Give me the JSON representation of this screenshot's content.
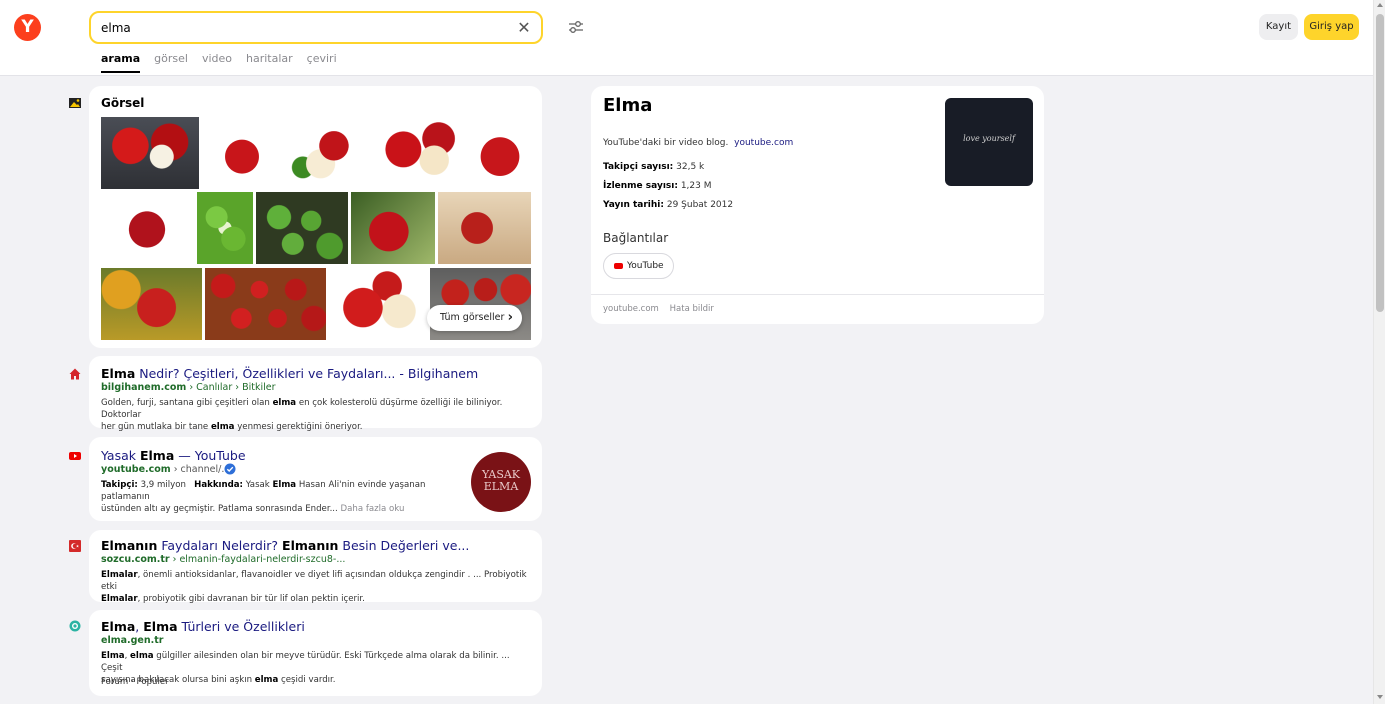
{
  "header": {
    "logo_text": "Y",
    "search_value": "elma",
    "tabs": [
      {
        "label": "arama",
        "active": true
      },
      {
        "label": "görsel",
        "active": false
      },
      {
        "label": "video",
        "active": false
      },
      {
        "label": "haritalar",
        "active": false
      },
      {
        "label": "çeviri",
        "active": false
      }
    ],
    "register_label": "Kayıt",
    "login_label": "Giriş yap"
  },
  "images": {
    "title": "Görsel",
    "all_label": "Tüm görseller"
  },
  "results": [
    {
      "title_pre": "",
      "title_b": "Elma",
      "title_post": " Nedir? Çeşitleri, Özellikleri ve Faydaları... - Bilgihanem",
      "url_host": "bilgihanem.com",
      "url_path": " › Canlılar › Bitkiler",
      "snippet_line1": "Golden, furji, santana gibi çeşitleri olan ",
      "snippet_b1": "elma",
      "snippet_line1b": " en çok kolesterolü düşürme özelliği ile biliniyor. Doktorlar",
      "snippet_line2": "her gün mutlaka bir tane ",
      "snippet_b2": "elma",
      "snippet_line2b": " yenmesi gerektiğini öneriyor."
    },
    {
      "title_pre": "Yasak ",
      "title_b": "Elma",
      "title_post": " — YouTube",
      "url_host": "youtube.com",
      "url_path": " › channel/...",
      "followers_label": "Takipçi:",
      "followers_value": " 3,9 milyon",
      "about_label": "Hakkında:",
      "about_text1": " Yasak ",
      "about_b": "Elma",
      "about_text2": " Hasan Ali'nin evinde yaşanan patlamanın",
      "about_line2": "üstünden altı ay geçmiştir. Patlama sonrasında Ender... ",
      "more_label": "Daha fazla oku",
      "thumb_text_1": "YASAK",
      "thumb_text_2": "ELMA"
    },
    {
      "title_b": "Elmanın",
      "title_mid": " Faydaları Nelerdir? ",
      "title_b2": "Elmanın",
      "title_post": " Besin Değerleri ve...",
      "url_host": "sozcu.com.tr",
      "url_path": " › elmanin-faydalari-nelerdir-szcu8-...",
      "snippet_b1": "Elmalar",
      "snippet_line1": ", önemli antioksidanlar, flavanoidler ve diyet lifi açısından oldukça zengindir . ... Probiyotik etki",
      "snippet_b2": "Elmalar",
      "snippet_line2": ", probiyotik gibi davranan bir tür lif olan pektin içerir."
    },
    {
      "title_b": "Elma",
      "title_mid": ", ",
      "title_b2": "Elma",
      "title_post": " Türleri ve Özellikleri",
      "url_host": "elma.gen.tr",
      "snippet_b1": "Elma",
      "snippet_mid": ", ",
      "snippet_b2": "elma",
      "snippet_line1": " gülgiller ailesinden olan bir meyve türüdür. Eski Türkçede alma olarak da bilinir. ... Çeşit",
      "snippet_line2a": "sayısına bakılacak olursa bini aşkın ",
      "snippet_b3": "elma",
      "snippet_line2b": " çeşidi vardır.",
      "links": [
        "Forum",
        "Popüler"
      ],
      "link_sep": "·"
    }
  ],
  "knowledge_panel": {
    "title": "Elma",
    "description": "YouTube'daki bir video blog.",
    "description_link": "youtube.com",
    "facts": [
      {
        "label": "Takipçi sayısı:",
        "value": " 32,5 k"
      },
      {
        "label": "İzlenme sayısı:",
        "value": " 1,23 M"
      },
      {
        "label": "Yayın tarihi:",
        "value": " 29 Şubat 2012"
      }
    ],
    "links_title": "Bağlantılar",
    "youtube_label": "YouTube",
    "footer_source": "youtube.com",
    "footer_report": "Hata bildir",
    "image_text": "love yourself"
  },
  "colors": {
    "brand_red": "#fc3f1d",
    "accent_yellow": "#fed42b",
    "link_blue": "#1a1a80",
    "url_green": "#1f6b29"
  }
}
